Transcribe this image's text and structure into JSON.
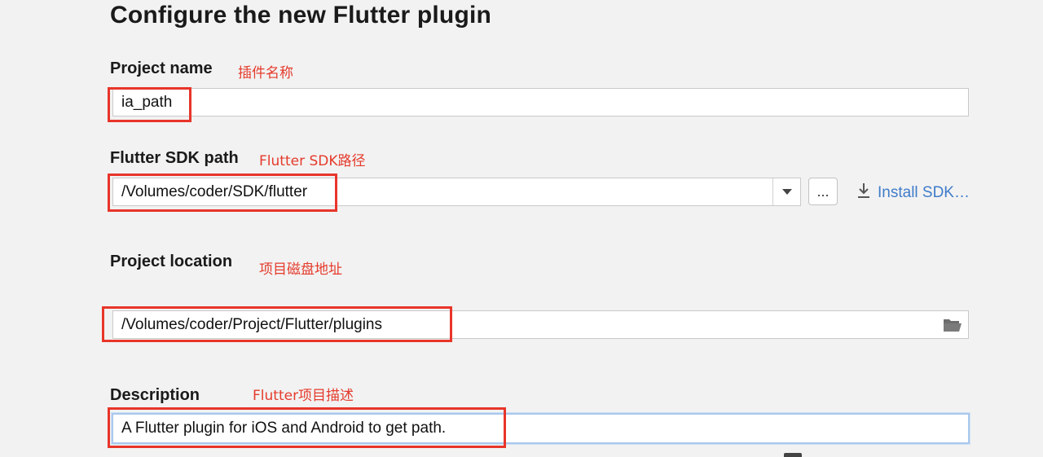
{
  "page": {
    "title": "Configure the new Flutter plugin"
  },
  "project_name": {
    "label": "Project name",
    "note": "插件名称",
    "value": "ia_path"
  },
  "sdk_path": {
    "label": "Flutter SDK path",
    "note": "Flutter SDK路径",
    "value": "/Volumes/coder/SDK/flutter",
    "browse_label": "...",
    "install_label": "Install SDK…",
    "icon_dropdown": "chevron-down-icon",
    "icon_install": "download-icon"
  },
  "project_location": {
    "label": "Project location",
    "note": "项目磁盘地址",
    "value": "/Volumes/coder/Project/Flutter/plugins",
    "icon_browse": "folder-icon"
  },
  "description": {
    "label": "Description",
    "note": "Flutter项目描述",
    "value": "A Flutter plugin for iOS and Android to get path."
  },
  "colors": {
    "background": "#f2f2f2",
    "annotation_red": "#e53b2c",
    "link_blue": "#3f7cc9",
    "focus_border": "#a9c8ec"
  }
}
